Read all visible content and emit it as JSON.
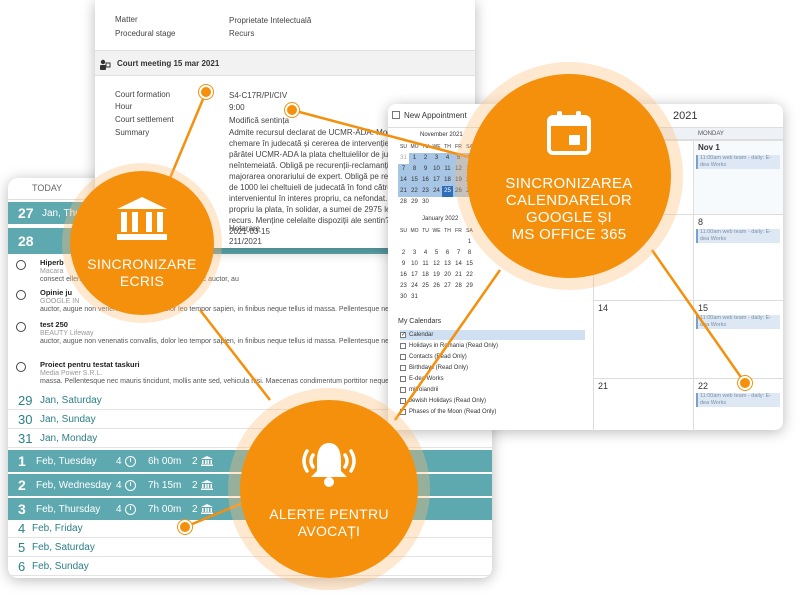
{
  "agenda": {
    "header": "TODAY",
    "row1": {
      "num": "27",
      "label": "Jan, Thursday"
    },
    "row2": {
      "num": "28"
    },
    "tasks": [
      {
        "title": "Hiperb",
        "sub": "Macara",
        "body": "consect                                       ellentesque, eu egestas purus tristique. Nunc auctor, au"
      },
      {
        "title": "Opinie ju",
        "sub": "GOOGLE IN",
        "body": "auctor, augue non venenatis convallis, dolor leo tempor sapien, in finibus neque tellus id massa. Pellentesque ne"
      },
      {
        "title": "test 250",
        "sub": "BEAUTY Lifeway",
        "body": "auctor, augue non venenatis convallis, dolor leo tempor sapien, in finibus neque tellus id massa. Pellentesque nec mollis"
      },
      {
        "title": "Proiect pentru testat taskuri",
        "sub": "Media Power S.R.L.",
        "body": "massa. Pellentesque nec mauris tincidunt, mollis ante sed, vehicula nisi. Maecenas condimentum porttitor neque"
      }
    ],
    "days": [
      {
        "num": "29",
        "label": "Jan, Saturday",
        "teal": false
      },
      {
        "num": "30",
        "label": "Jan, Sunday",
        "teal": false
      },
      {
        "num": "31",
        "label": "Jan, Monday",
        "teal": false
      },
      {
        "num": "1",
        "label": "Feb, Tuesday",
        "teal": true,
        "tasks": "4",
        "hours": "6h 00m",
        "cases": "2"
      },
      {
        "num": "2",
        "label": "Feb, Wednesday",
        "teal": true,
        "tasks": "4",
        "hours": "7h 15m",
        "cases": "2"
      },
      {
        "num": "3",
        "label": "Feb, Thursday",
        "teal": true,
        "tasks": "4",
        "hours": "7h 00m",
        "cases": "2"
      },
      {
        "num": "4",
        "label": "Feb, Friday",
        "teal": false
      },
      {
        "num": "5",
        "label": "Feb, Saturday",
        "teal": false
      },
      {
        "num": "6",
        "label": "Feb, Sunday",
        "teal": false
      }
    ]
  },
  "detail": {
    "matter_label": "Matter",
    "matter_value": "Proprietate Intelectuală",
    "stage_label": "Procedural stage",
    "stage_value": "Recurs",
    "section_title": "Court meeting 15 mar 2021",
    "formation_label": "Court formation",
    "formation_value": "S4-C17R/PI/CIV",
    "hour_label": "Hour",
    "hour_value": "9:00",
    "settlement_label": "Court settlement",
    "settlement_value": "Modifică sentința",
    "summary_label": "Summary",
    "summary_lines": [
      "Admite recursul declarat de UCMR-ADA. Modifică",
      "chemare în judecată și cererea de intervenție in i",
      "părâtei UCMR-ADA la plata cheltuielilor de judeca",
      "neîntemeiată. Obligă pe recurenții-reclamanți și p",
      "majorarea onorariului de expert. Obligă pe reclam",
      "de 1000 lei cheltuieli de judecată în fond către pâ",
      "intervenientul în interes propriu, ca nefondat. Obli",
      "propriu la plata, în solidar, a sumei de 2975 lei, că",
      "recurs. Menține celelalte dispoziții ale sentin?e/.",
      "2021-03-15"
    ],
    "doc_type": "Hotarare",
    "doc_number": "211/2021"
  },
  "calendar": {
    "window_title": "New Appointment",
    "year_header": "2021",
    "mini1_title": "November 2021",
    "mini2_title": "January 2022",
    "weekdays": [
      "SU",
      "MO",
      "TU",
      "WE",
      "TH",
      "FR",
      "SA"
    ],
    "mini1_days": [
      "31",
      "1",
      "2",
      "3",
      "4",
      "5",
      "6",
      "7",
      "8",
      "9",
      "10",
      "11",
      "12",
      "13",
      "14",
      "15",
      "16",
      "17",
      "18",
      "19",
      "20",
      "21",
      "22",
      "23",
      "24",
      "25",
      "26",
      "27",
      "28",
      "29",
      "30"
    ],
    "mini2_days": [
      "",
      "",
      "",
      "",
      "",
      "",
      "1",
      "2",
      "3",
      "4",
      "5",
      "6",
      "7",
      "8",
      "9",
      "10",
      "11",
      "12",
      "13",
      "14",
      "15",
      "16",
      "17",
      "18",
      "19",
      "20",
      "21",
      "22",
      "23",
      "24",
      "25",
      "26",
      "27",
      "28",
      "29",
      "30",
      "31"
    ],
    "my_calendars": "My Calendars",
    "calendars": [
      {
        "name": "Calendar",
        "checked": true
      },
      {
        "name": "Holidays in Romania (Read Only)",
        "checked": false
      },
      {
        "name": "Contacts (Read Only)",
        "checked": false
      },
      {
        "name": "Birthdays (Read Only)",
        "checked": false
      },
      {
        "name": "E-dea Works",
        "checked": false
      },
      {
        "name": "mitroiandrii",
        "checked": false
      },
      {
        "name": "Jewish Holidays (Read Only)",
        "checked": false
      },
      {
        "name": "Phases of the Moon (Read Only)",
        "checked": false
      }
    ],
    "weekday_header": "MONDAY",
    "nov1": "Nov 1",
    "d8": "8",
    "d14": "14",
    "d15": "15",
    "d21": "21",
    "d22": "22",
    "event_text": "11:00am web team - daily: E-dea Works"
  },
  "bubbles": {
    "ecris_line1": "SINCRONIZARE",
    "ecris_line2": "ECRIS",
    "cal_line1": "SINCRONIZAREA",
    "cal_line2": "CALENDARELOR",
    "cal_line3": "GOOGLE ȘI",
    "cal_line4": "MS OFFICE 365",
    "alert_line1": "ALERTE PENTRU",
    "alert_line2": "AVOCAȚI"
  },
  "colors": {
    "orange": "#f4900c",
    "teal": "#5ea9b0",
    "teal_text": "#2b7f88"
  }
}
